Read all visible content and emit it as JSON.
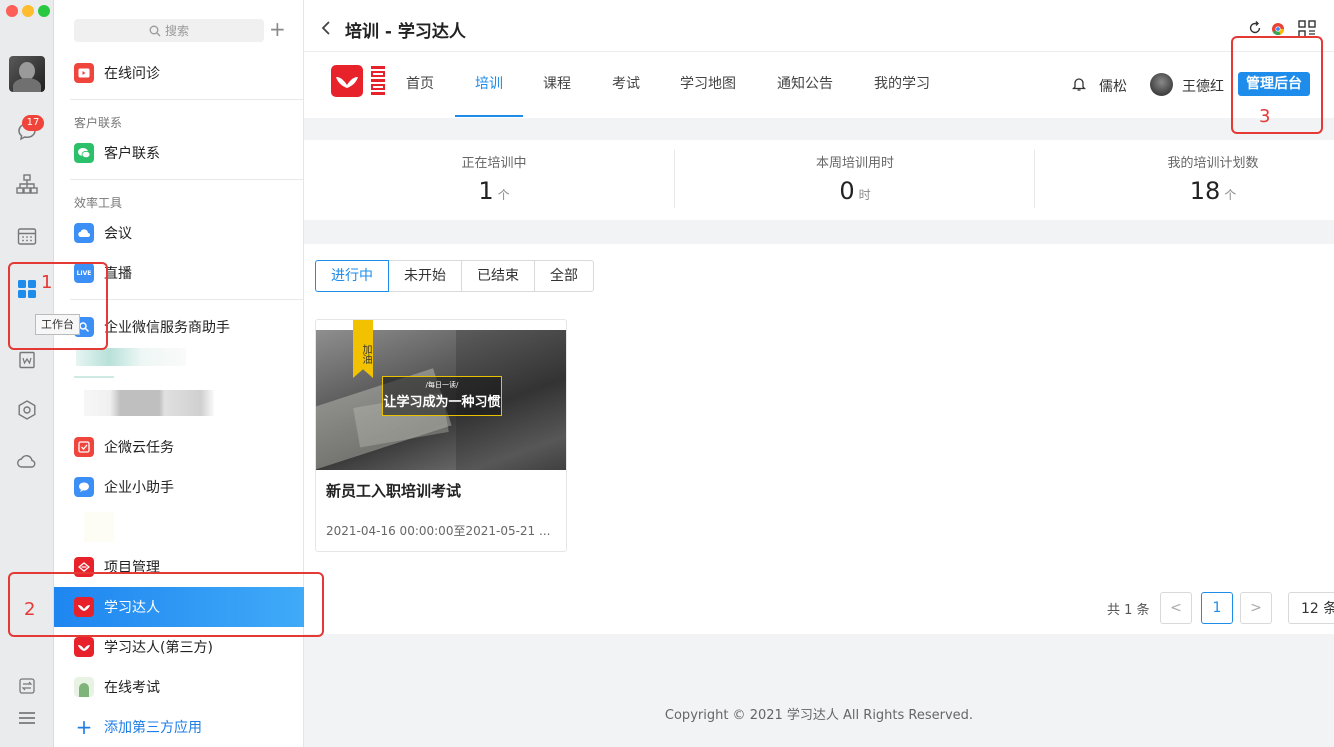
{
  "rail": {
    "badge": "17",
    "tooltip": "工作台"
  },
  "applist": {
    "search_placeholder": "搜索",
    "sections": {
      "customer": "客户联系",
      "efficiency": "效率工具"
    },
    "apps": {
      "online_consult": "在线问诊",
      "customer_contact": "客户联系",
      "meeting": "会议",
      "live": "直播",
      "live_badge": "LIVE",
      "wecom_helper": "企业微信服务商助手",
      "cloud_task": "企微云任务",
      "assistant": "企业小助手",
      "project": "项目管理",
      "xuexi": "学习达人",
      "xuexi_third": "学习达人(第三方)",
      "exam": "在线考试",
      "add_third": "添加第三方应用"
    }
  },
  "main": {
    "title": "培训 - 学习达人",
    "nav": [
      "首页",
      "培训",
      "课程",
      "考试",
      "学习地图",
      "通知公告",
      "我的学习"
    ],
    "user1": "儒松",
    "user2": "王德红",
    "admin_button": "管理后台",
    "stats": [
      {
        "label": "正在培训中",
        "value": "1",
        "unit": "个"
      },
      {
        "label": "本周培训用时",
        "value": "0",
        "unit": "时"
      },
      {
        "label": "我的培训计划数",
        "value": "18",
        "unit": "个"
      }
    ],
    "tabs": [
      "进行中",
      "未开始",
      "已结束",
      "全部"
    ],
    "card": {
      "ribbon": "加油",
      "img_small": "/每日一读/",
      "img_big": "让学习成为一种习惯",
      "title": "新员工入职培训考试",
      "date": "2021-04-16 00:00:00至2021-05-21 ..."
    },
    "pager": {
      "total": "共 1 条",
      "prev": "<",
      "page": "1",
      "next": ">",
      "size": "12 条"
    },
    "footer": "Copyright © 2021 学习达人 All Rights Reserved."
  },
  "annotations": {
    "a1": "1",
    "a2": "2",
    "a3": "3"
  },
  "colors": {
    "accent": "#1e8ceb",
    "red": "#e53935",
    "brand_red": "#e8222a"
  }
}
